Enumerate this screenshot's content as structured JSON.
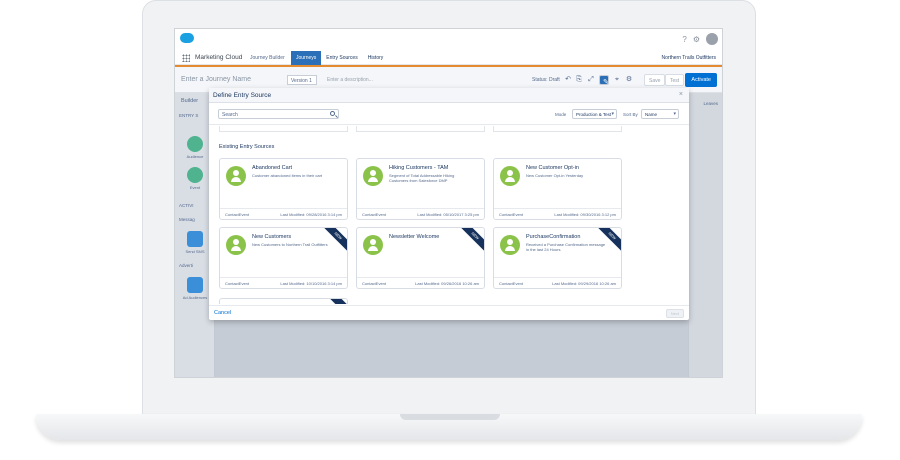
{
  "header": {
    "app_name": "Marketing Cloud",
    "breadcrumb": "Journey Builder",
    "tabs": [
      "Journeys",
      "Entry Sources",
      "History"
    ],
    "org_name": "Northern Trails Outfitters",
    "help_icon": "?",
    "settings_icon": "⚙"
  },
  "journey": {
    "name_placeholder": "Enter a Journey Name",
    "version": "Version 1",
    "description_placeholder": "Enter a description...",
    "status": "Status: Draft",
    "save_label": "Save",
    "test_label": "Test",
    "activate_label": "Activate"
  },
  "builder": {
    "title": "Builder",
    "entry_section": "ENTRY S",
    "activities_section": "ACTIVI",
    "messages_section": "Messag",
    "advertising_section": "Adverti",
    "items": [
      "Audience",
      "Event",
      "Send SMS",
      "Ad Audiences"
    ],
    "right_rail_label": "Leaves"
  },
  "modal": {
    "title": "Define Entry Source",
    "search_placeholder": "Search",
    "mode_label": "Mode",
    "mode_value": "Production & Test",
    "sort_label": "Sort By",
    "sort_value": "Name",
    "section_title": "Existing Entry Sources",
    "cancel_label": "Cancel",
    "next_label": "Next",
    "cards": [
      {
        "title": "Abandoned Cart",
        "desc": "Customer abandoned items in their cart",
        "type": "ContactEvent",
        "modified": "Last Modified: 09/28/2016 3:14 pm",
        "badge": ""
      },
      {
        "title": "Hiking Customers - TAM",
        "desc": "Segment of Total Addressable Hiking Customers from Salesforce DMP",
        "type": "ContactEvent",
        "modified": "Last Modified: 05/10/2017 3:25 pm",
        "badge": ""
      },
      {
        "title": "New Customer Opt-in",
        "desc": "New Customer Opt-in Yesterday",
        "type": "ContactEvent",
        "modified": "Last Modified: 09/30/2016 3:12 pm",
        "badge": ""
      },
      {
        "title": "New Customers",
        "desc": "New Customers to Northern Trail Outfitters",
        "type": "ContactEvent",
        "modified": "Last Modified: 10/10/2016 3:14 pm",
        "badge": "NEW"
      },
      {
        "title": "Newsletter Welcome",
        "desc": "",
        "type": "ContactEvent",
        "modified": "Last Modified: 09/26/2016 10:26 am",
        "badge": "NEW"
      },
      {
        "title": "PurchaseConfirmation",
        "desc": "Received a Purchase Confirmation message in the last 24 Hours",
        "type": "ContactEvent",
        "modified": "Last Modified: 09/29/2016 10:26 am",
        "badge": "NEW"
      }
    ]
  }
}
